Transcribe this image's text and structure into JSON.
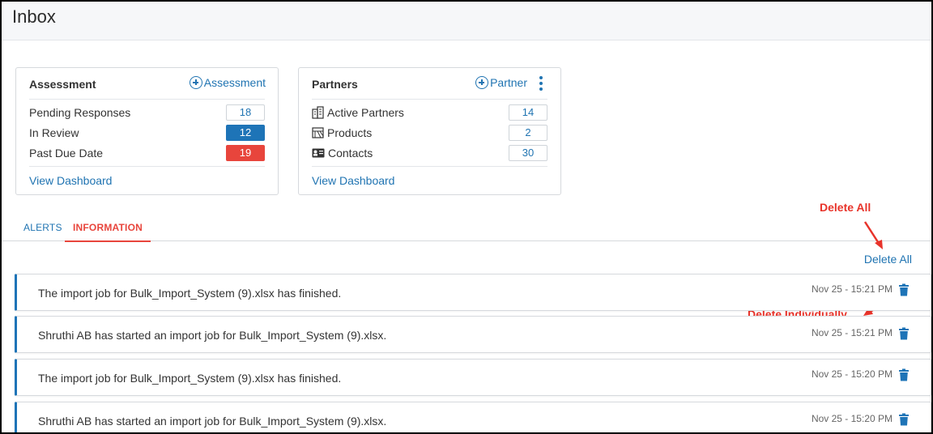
{
  "page": {
    "title": "Inbox"
  },
  "assessment": {
    "title": "Assessment",
    "add_label": "Assessment",
    "rows": [
      {
        "label": "Pending Responses",
        "value": "18",
        "style": "plain"
      },
      {
        "label": "In Review",
        "value": "12",
        "style": "blue"
      },
      {
        "label": "Past Due Date",
        "value": "19",
        "style": "red"
      }
    ],
    "view_dashboard": "View Dashboard"
  },
  "partners": {
    "title": "Partners",
    "add_label": "Partner",
    "rows": [
      {
        "label": "Active Partners",
        "value": "14",
        "icon": "building-icon"
      },
      {
        "label": "Products",
        "value": "2",
        "icon": "products-icon"
      },
      {
        "label": "Contacts",
        "value": "30",
        "icon": "contact-card-icon"
      }
    ],
    "view_dashboard": "View Dashboard"
  },
  "tabs": [
    {
      "label": "ALERTS",
      "active": false
    },
    {
      "label": "INFORMATION",
      "active": true
    }
  ],
  "delete_all_label": "Delete All",
  "annotations": {
    "delete_all": "Delete All",
    "delete_individually": "Delete Individually"
  },
  "messages": [
    {
      "text": "The import job for Bulk_Import_System (9).xlsx has finished.",
      "time": "Nov 25 - 15:21 PM"
    },
    {
      "text": "Shruthi AB has started an import job for Bulk_Import_System (9).xlsx.",
      "time": "Nov 25 - 15:21 PM"
    },
    {
      "text": "The import job for Bulk_Import_System (9).xlsx has finished.",
      "time": "Nov 25 - 15:20 PM"
    },
    {
      "text": "Shruthi AB has started an import job for Bulk_Import_System (9).xlsx.",
      "time": "Nov 25 - 15:20 PM"
    }
  ],
  "colors": {
    "accent": "#2074b2",
    "danger": "#e8453c",
    "annotation": "#e8332a"
  }
}
